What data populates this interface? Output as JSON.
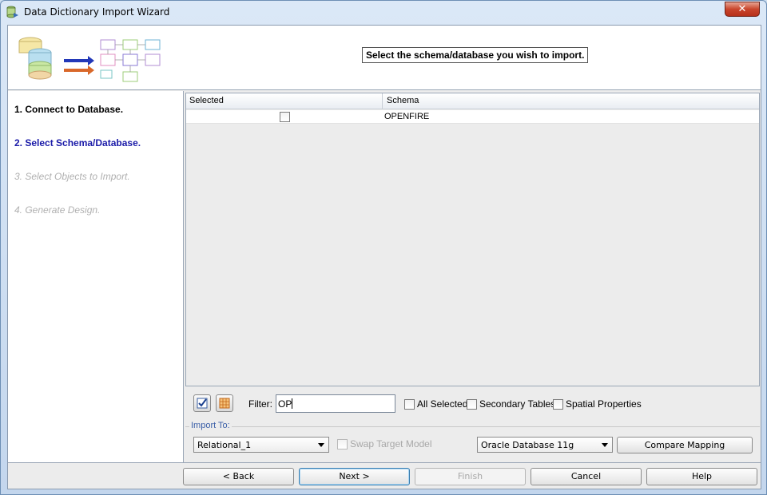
{
  "window": {
    "title": "Data Dictionary Import Wizard",
    "close_label": "✕"
  },
  "header": {
    "title": "Select the schema/database you wish to import."
  },
  "steps": [
    {
      "label": "1. Connect to Database.",
      "state": "done"
    },
    {
      "label": "2. Select Schema/Database.",
      "state": "current"
    },
    {
      "label": "3. Select Objects to Import.",
      "state": "future"
    },
    {
      "label": "4. Generate Design.",
      "state": "future"
    }
  ],
  "table": {
    "columns": [
      "Selected",
      "Schema"
    ],
    "rows": [
      {
        "selected": false,
        "schema": "OPENFIRE"
      }
    ]
  },
  "filter": {
    "label": "Filter:",
    "value": "OP",
    "all_selected": "All Selected",
    "secondary_tables": "Secondary Tables",
    "spatial_properties": "Spatial Properties"
  },
  "import_to": {
    "group_label": "Import To:",
    "model": "Relational_1",
    "swap_target": "Swap Target Model",
    "database": "Oracle Database 11g",
    "compare_mapping": "Compare Mapping"
  },
  "nav": {
    "back": "< Back",
    "next": "Next >",
    "finish": "Finish",
    "cancel": "Cancel",
    "help": "Help"
  },
  "colors": {
    "current_step": "#1a1aa8",
    "future_step": "#b0b0b0",
    "group_title": "#3b5fa8"
  }
}
